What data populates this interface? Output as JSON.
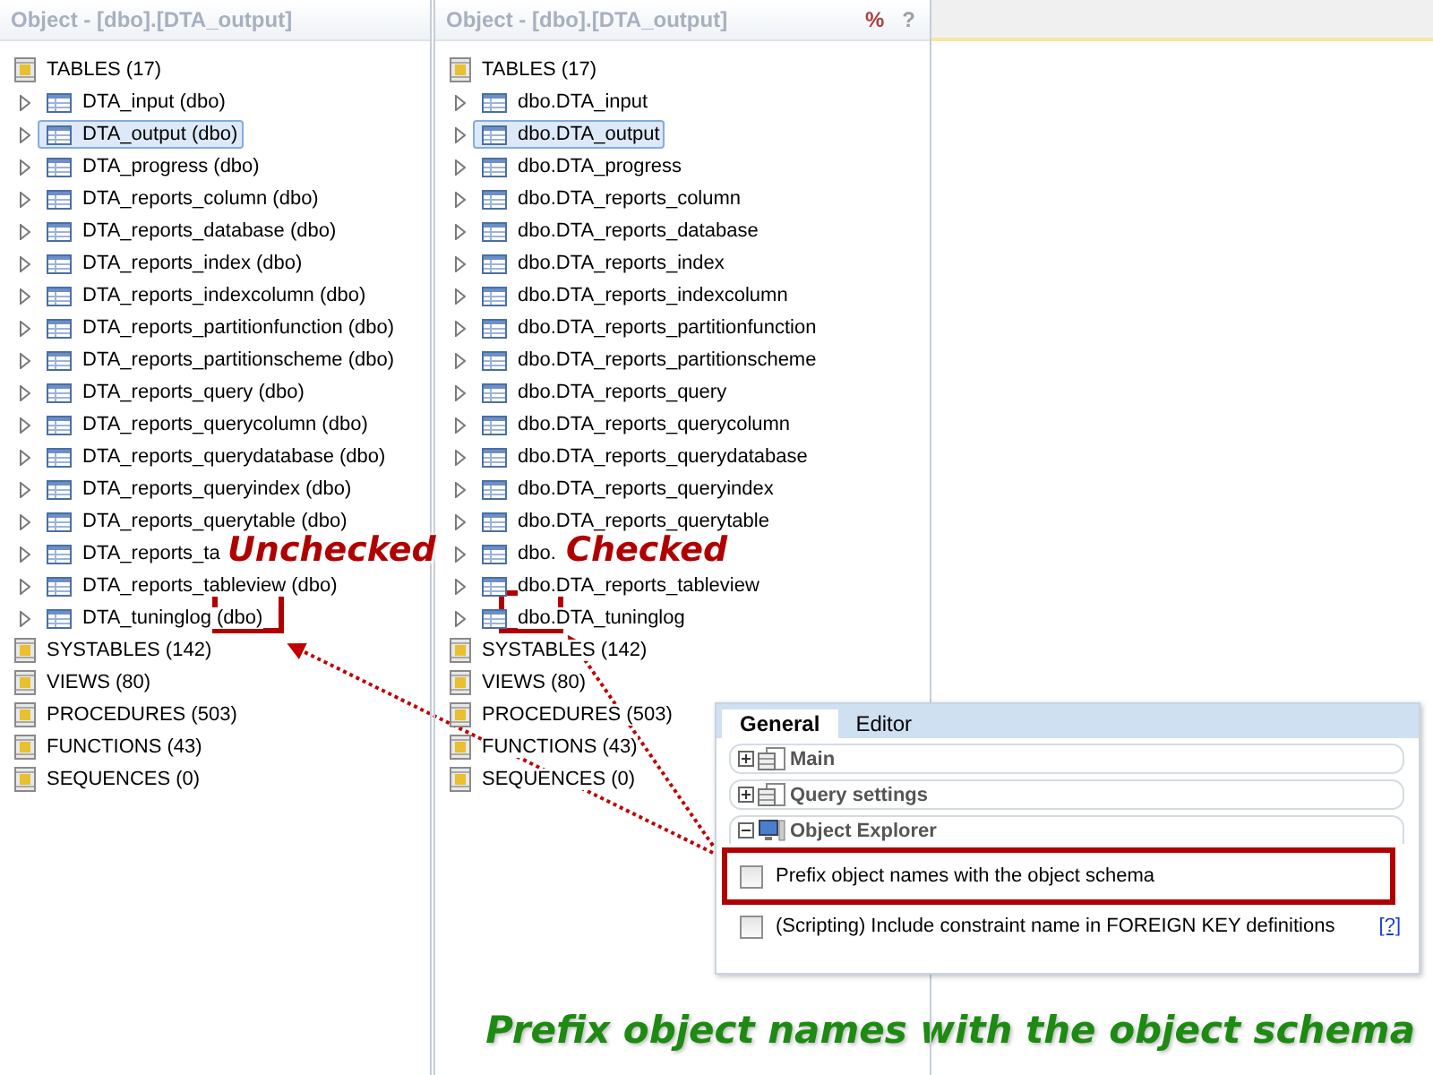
{
  "panels": [
    {
      "title": "Object - [dbo].[DTA_output]",
      "categories": [
        {
          "label": "TABLES (17)",
          "children": [
            {
              "label": "DTA_input (dbo)",
              "selected": false
            },
            {
              "label": "DTA_output (dbo)",
              "selected": true
            },
            {
              "label": "DTA_progress (dbo)",
              "selected": false
            },
            {
              "label": "DTA_reports_column (dbo)",
              "selected": false
            },
            {
              "label": "DTA_reports_database (dbo)",
              "selected": false
            },
            {
              "label": "DTA_reports_index (dbo)",
              "selected": false
            },
            {
              "label": "DTA_reports_indexcolumn (dbo)",
              "selected": false
            },
            {
              "label": "DTA_reports_partitionfunction (dbo)",
              "selected": false
            },
            {
              "label": "DTA_reports_partitionscheme (dbo)",
              "selected": false
            },
            {
              "label": "DTA_reports_query (dbo)",
              "selected": false
            },
            {
              "label": "DTA_reports_querycolumn (dbo)",
              "selected": false
            },
            {
              "label": "DTA_reports_querydatabase (dbo)",
              "selected": false
            },
            {
              "label": "DTA_reports_queryindex (dbo)",
              "selected": false
            },
            {
              "label": "DTA_reports_querytable (dbo)",
              "selected": false
            },
            {
              "label": "DTA_reports_ta",
              "selected": false
            },
            {
              "label": "DTA_reports_tableview (dbo)",
              "selected": false
            },
            {
              "label": "DTA_tuninglog (dbo)",
              "selected": false
            }
          ]
        },
        {
          "label": "SYSTABLES (142)"
        },
        {
          "label": "VIEWS (80)"
        },
        {
          "label": "PROCEDURES (503)"
        },
        {
          "label": "FUNCTIONS (43)"
        },
        {
          "label": "SEQUENCES (0)"
        }
      ]
    },
    {
      "title": "Object - [dbo].[DTA_output]",
      "title_buttons": [
        "%",
        "?"
      ],
      "categories": [
        {
          "label": "TABLES (17)",
          "children": [
            {
              "label": "dbo.DTA_input",
              "selected": false
            },
            {
              "label": "dbo.DTA_output",
              "selected": true
            },
            {
              "label": "dbo.DTA_progress",
              "selected": false
            },
            {
              "label": "dbo.DTA_reports_column",
              "selected": false
            },
            {
              "label": "dbo.DTA_reports_database",
              "selected": false
            },
            {
              "label": "dbo.DTA_reports_index",
              "selected": false
            },
            {
              "label": "dbo.DTA_reports_indexcolumn",
              "selected": false
            },
            {
              "label": "dbo.DTA_reports_partitionfunction",
              "selected": false
            },
            {
              "label": "dbo.DTA_reports_partitionscheme",
              "selected": false
            },
            {
              "label": "dbo.DTA_reports_query",
              "selected": false
            },
            {
              "label": "dbo.DTA_reports_querycolumn",
              "selected": false
            },
            {
              "label": "dbo.DTA_reports_querydatabase",
              "selected": false
            },
            {
              "label": "dbo.DTA_reports_queryindex",
              "selected": false
            },
            {
              "label": "dbo.DTA_reports_querytable",
              "selected": false
            },
            {
              "label": "dbo.",
              "selected": false
            },
            {
              "label": "dbo.DTA_reports_tableview",
              "selected": false
            },
            {
              "label": "dbo.DTA_tuninglog",
              "selected": false
            }
          ]
        },
        {
          "label": "SYSTABLES (142)"
        },
        {
          "label": "VIEWS (80)"
        },
        {
          "label": "PROCEDURES (503)"
        },
        {
          "label": "FUNCTIONS (43)"
        },
        {
          "label": "SEQUENCES (0)"
        }
      ]
    }
  ],
  "callouts": [
    "Unchecked",
    "Checked"
  ],
  "options_dialog": {
    "tabs": [
      {
        "label": "General",
        "selected": true
      },
      {
        "label": "Editor",
        "selected": false
      }
    ],
    "sections": [
      {
        "label": "Main",
        "expanded": false
      },
      {
        "label": "Query settings",
        "expanded": false
      },
      {
        "label": "Object Explorer",
        "expanded": true
      }
    ],
    "options": [
      {
        "label": "Prefix object names with the object schema",
        "checked": false
      },
      {
        "label": "(Scripting) Include constraint name in FOREIGN KEY definitions",
        "checked": false,
        "help": "[?]"
      }
    ]
  },
  "caption": "Prefix object names with the object schema"
}
